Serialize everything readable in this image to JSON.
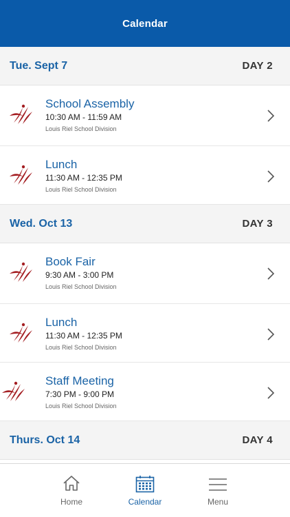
{
  "header": {
    "title": "Calendar"
  },
  "days": [
    {
      "date": "Tue. Sept 7",
      "day_label": "DAY 2",
      "events": [
        {
          "title": "School Assembly",
          "time": "10:30 AM - 11:59 AM",
          "org": "Louis Riel School Division"
        },
        {
          "title": "Lunch",
          "time": "11:30 AM - 12:35 PM",
          "org": "Louis Riel School Division"
        }
      ]
    },
    {
      "date": "Wed. Oct 13",
      "day_label": "DAY 3",
      "events": [
        {
          "title": "Book Fair",
          "time": "9:30 AM - 3:00 PM",
          "org": "Louis Riel School Division"
        },
        {
          "title": "Lunch",
          "time": "11:30 AM - 12:35 PM",
          "org": "Louis Riel School Division"
        },
        {
          "title": "Staff Meeting",
          "time": "7:30 PM - 9:00 PM",
          "org": "Louis Riel School Division"
        }
      ]
    },
    {
      "date": "Thurs. Oct 14",
      "day_label": "DAY 4",
      "events": []
    }
  ],
  "tabbar": {
    "home": "Home",
    "calendar": "Calendar",
    "menu": "Menu",
    "active": "calendar"
  },
  "colors": {
    "header_bg": "#0a5aa9",
    "accent": "#1a63a6",
    "logo": "#a41e22"
  },
  "icons": {
    "event_logo": "school-division-logo-icon",
    "row_action": "chevron-right-icon",
    "home": "home-icon",
    "calendar": "calendar-icon",
    "menu": "hamburger-menu-icon"
  }
}
